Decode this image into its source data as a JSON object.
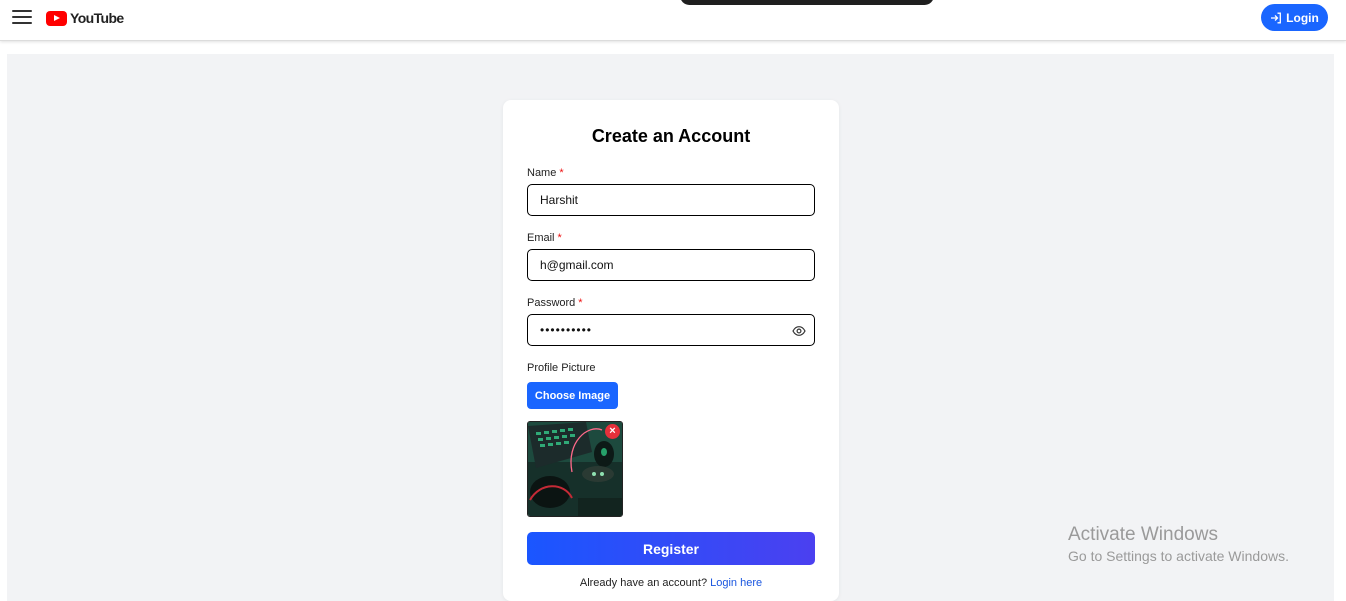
{
  "header": {
    "logo_text": "YouTube",
    "login_label": "Login",
    "brand_color": "#ff0000",
    "accent_color": "#1a66ff"
  },
  "form": {
    "title": "Create an Account",
    "required_mark": "*",
    "name_label": "Name",
    "name_value": "Harshit",
    "email_label": "Email",
    "email_value": "h@gmail.com",
    "password_label": "Password",
    "password_value": "••••••••••",
    "profile_label": "Profile Picture",
    "choose_image_label": "Choose Image",
    "remove_icon": "×",
    "register_label": "Register",
    "footer_prompt": "Already have an account?",
    "footer_link": "Login here"
  },
  "watermark": {
    "title": "Activate Windows",
    "subtitle": "Go to Settings to activate Windows."
  }
}
